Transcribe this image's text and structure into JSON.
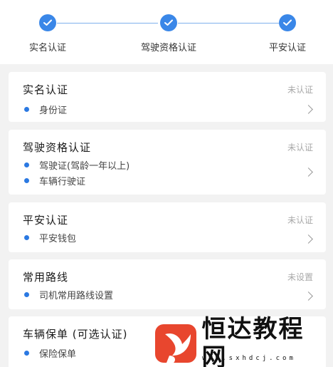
{
  "steps": [
    {
      "label": "实名认证"
    },
    {
      "label": "驾驶资格认证"
    },
    {
      "label": "平安认证"
    }
  ],
  "cards": [
    {
      "title": "实名认证",
      "status": "未认证",
      "items": [
        "身份证"
      ]
    },
    {
      "title": "驾驶资格认证",
      "status": "未认证",
      "items": [
        "驾驶证(驾龄一年以上)",
        "车辆行驶证"
      ]
    },
    {
      "title": "平安认证",
      "status": "未认证",
      "items": [
        "平安钱包"
      ]
    },
    {
      "title": "常用路线",
      "status": "未设置",
      "items": [
        "司机常用路线设置"
      ]
    },
    {
      "title": "车辆保单 (可选认证)",
      "status": "",
      "items": [
        "保险保单"
      ]
    }
  ],
  "watermark": {
    "brand": "恒达教程网",
    "url": "www.sxhdcj.com"
  },
  "colors": {
    "accent": "#3a87e8",
    "dot": "#2b79e2",
    "status_text": "#a8a8a8",
    "watermark_logo": "#e8462e"
  },
  "icons": {
    "step_done": "check-circle-icon",
    "item_marker": "blue-dot-icon",
    "card_action": "chevron-right-icon"
  }
}
